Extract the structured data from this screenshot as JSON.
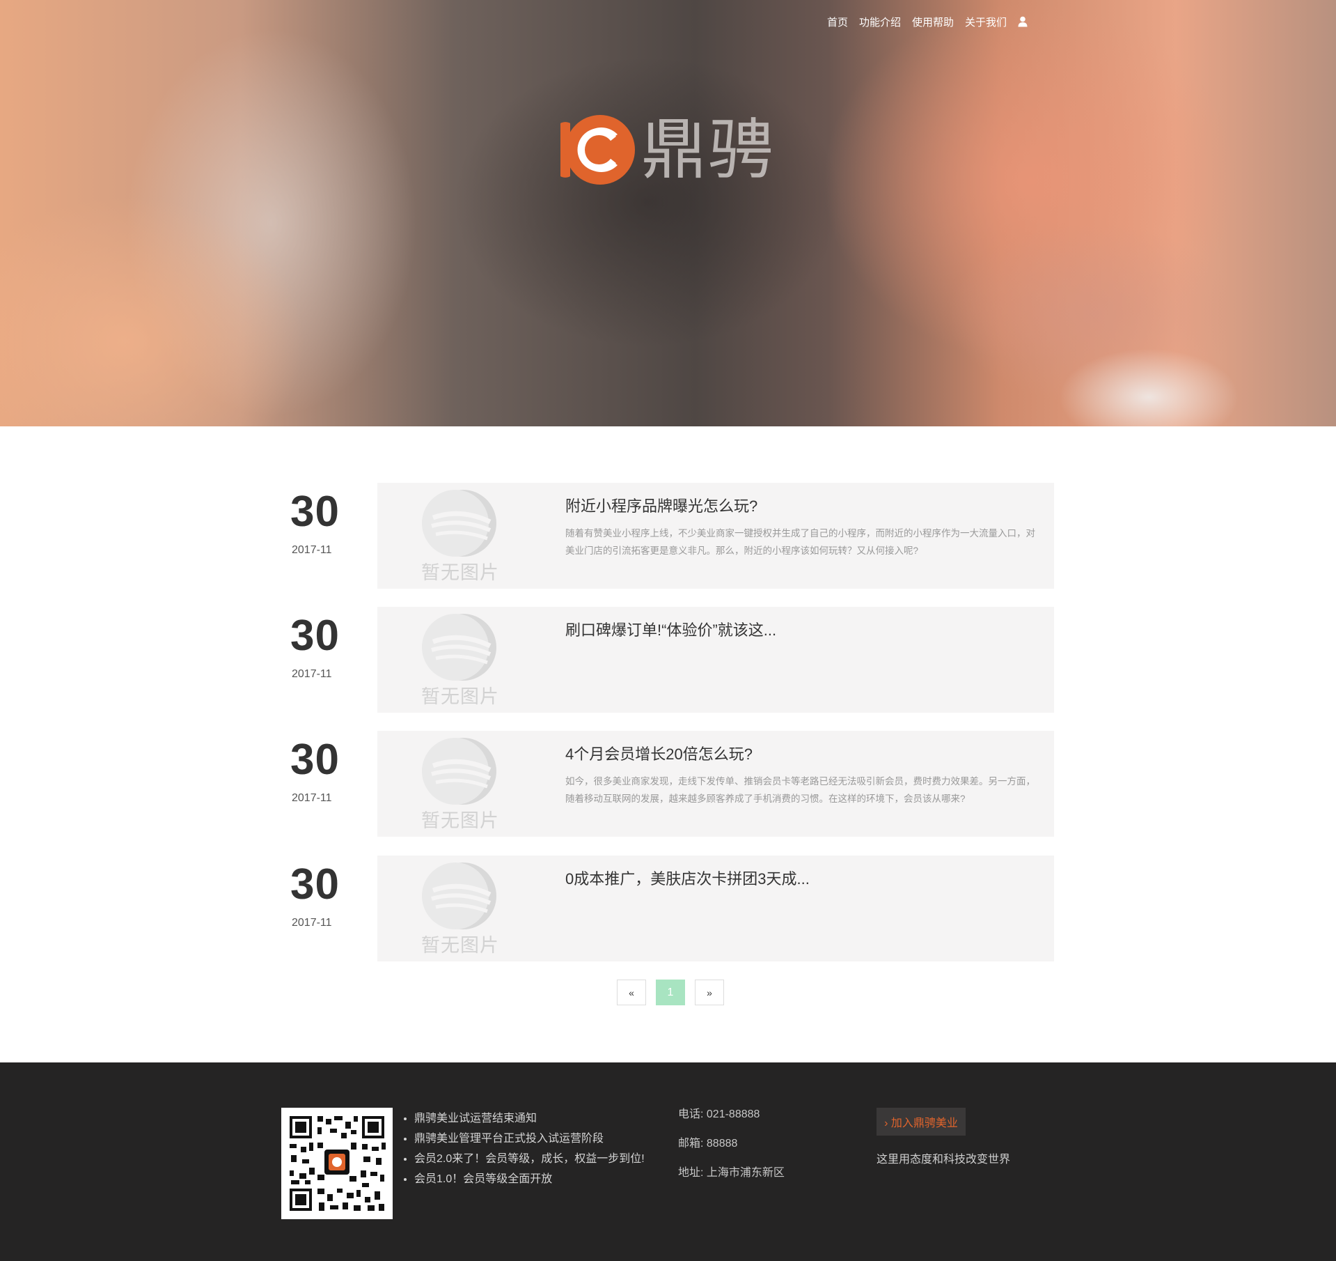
{
  "nav": {
    "items": [
      {
        "label": "首页"
      },
      {
        "label": "功能介绍"
      },
      {
        "label": "使用帮助"
      },
      {
        "label": "关于我们"
      }
    ],
    "user_icon": "user-icon"
  },
  "brand": {
    "name": "鼎骋",
    "accent_color": "#e0642c"
  },
  "articles": [
    {
      "day": "30",
      "year_month": "2017-11",
      "thumb_caption": "暂无图片",
      "title": "附近小程序品牌曝光怎么玩?",
      "description": "随着有赞美业小程序上线，不少美业商家一键授权并生成了自己的小程序，而附近的小程序作为一大流量入口，对美业门店的引流拓客更是意义非凡。那么，附近的小程序该如何玩转？又从何接入呢?"
    },
    {
      "day": "30",
      "year_month": "2017-11",
      "thumb_caption": "暂无图片",
      "title": "刷口碑爆订单!“体验价”就该这...",
      "description": ""
    },
    {
      "day": "30",
      "year_month": "2017-11",
      "thumb_caption": "暂无图片",
      "title": "4个月会员增长20倍怎么玩?",
      "description": "如今，很多美业商家发现，走线下发传单、推销会员卡等老路已经无法吸引新会员，费时费力效果差。另一方面，随着移动互联网的发展，越来越多顾客养成了手机消费的习惯。在这样的环境下，会员该从哪来?"
    },
    {
      "day": "30",
      "year_month": "2017-11",
      "thumb_caption": "暂无图片",
      "title": "0成本推广，美肤店次卡拼团3天成...",
      "description": ""
    }
  ],
  "pagination": {
    "prev": "«",
    "current": "1",
    "next": "»",
    "active_color": "#a8e4c1"
  },
  "footer": {
    "notices": [
      "鼎骋美业试运营结束通知",
      "鼎骋美业管理平台正式投入试运营阶段",
      "会员2.0来了！会员等级，成长，权益一步到位!",
      "会员1.0！会员等级全面开放"
    ],
    "phone": "电话: 021-88888",
    "email": "邮箱: 88888",
    "address": "地址: 上海市浦东新区",
    "join_label": "› 加入鼎骋美业",
    "slogan": "这里用态度和科技改变世界",
    "background_color": "#252424"
  }
}
